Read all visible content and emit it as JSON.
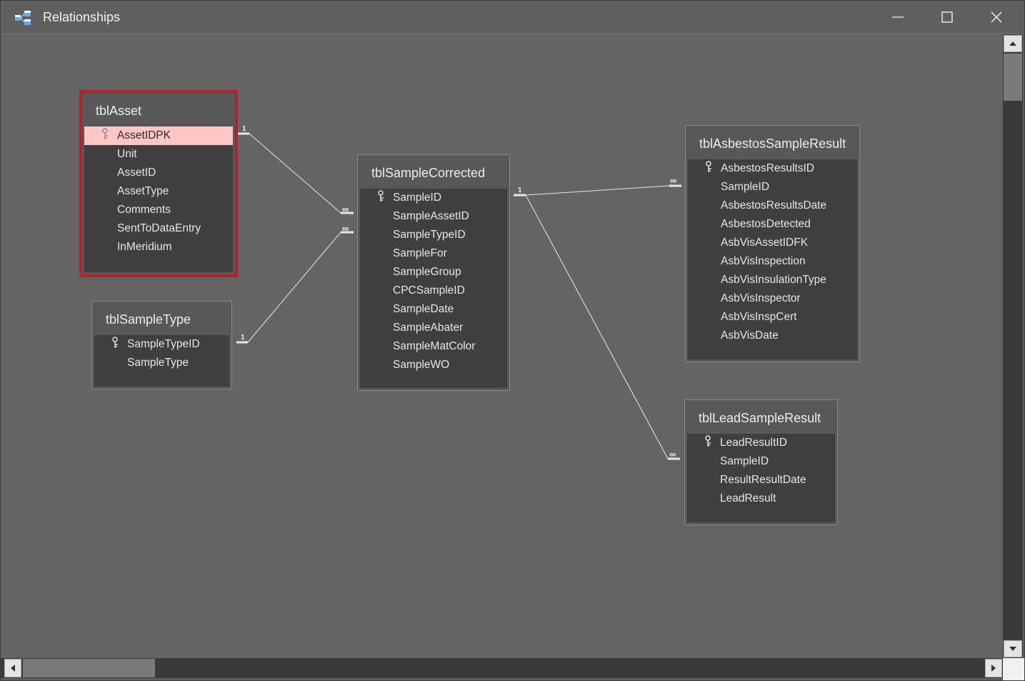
{
  "window": {
    "title": "Relationships",
    "icon": "relationships-icon",
    "controls": [
      "minimize-icon",
      "maximize-icon",
      "close-icon"
    ]
  },
  "colors": {
    "background": "#646464",
    "table_body": "#3f3f3f",
    "selection_border": "#b3222a",
    "selected_field": "#ffc6c6",
    "relationship_line": "#e8e8e8"
  },
  "tables": {
    "tblAsset": {
      "name": "tblAsset",
      "fields": [
        "AssetIDPK",
        "Unit",
        "AssetID",
        "AssetType",
        "Comments",
        "SentToDataEntry",
        "InMeridium"
      ]
    },
    "tblSampleType": {
      "name": "tblSampleType",
      "fields": [
        "SampleTypeID",
        "SampleType"
      ]
    },
    "tblSampleCorrected": {
      "name": "tblSampleCorrected",
      "fields": [
        "SampleID",
        "SampleAssetID",
        "SampleTypeID",
        "SampleFor",
        "SampleGroup",
        "CPCSampleID",
        "SampleDate",
        "SampleAbater",
        "SampleMatColor",
        "SampleWO"
      ]
    },
    "tblAsbestosSampleResult": {
      "name": "tblAsbestosSampleResult",
      "fields": [
        "AsbestosResultsID",
        "SampleID",
        "AsbestosResultsDate",
        "AsbestosDetected",
        "AsbVisAssetIDFK",
        "AsbVisInspection",
        "AsbVisInsulationType",
        "AsbVisInspector",
        "AsbVisInspCert",
        "AsbVisDate"
      ]
    },
    "tblLeadSampleResult": {
      "name": "tblLeadSampleResult",
      "fields": [
        "LeadResultID",
        "SampleID",
        "ResultResultDate",
        "LeadResult"
      ]
    }
  },
  "relationships": {
    "one": "1",
    "many": "∞"
  }
}
